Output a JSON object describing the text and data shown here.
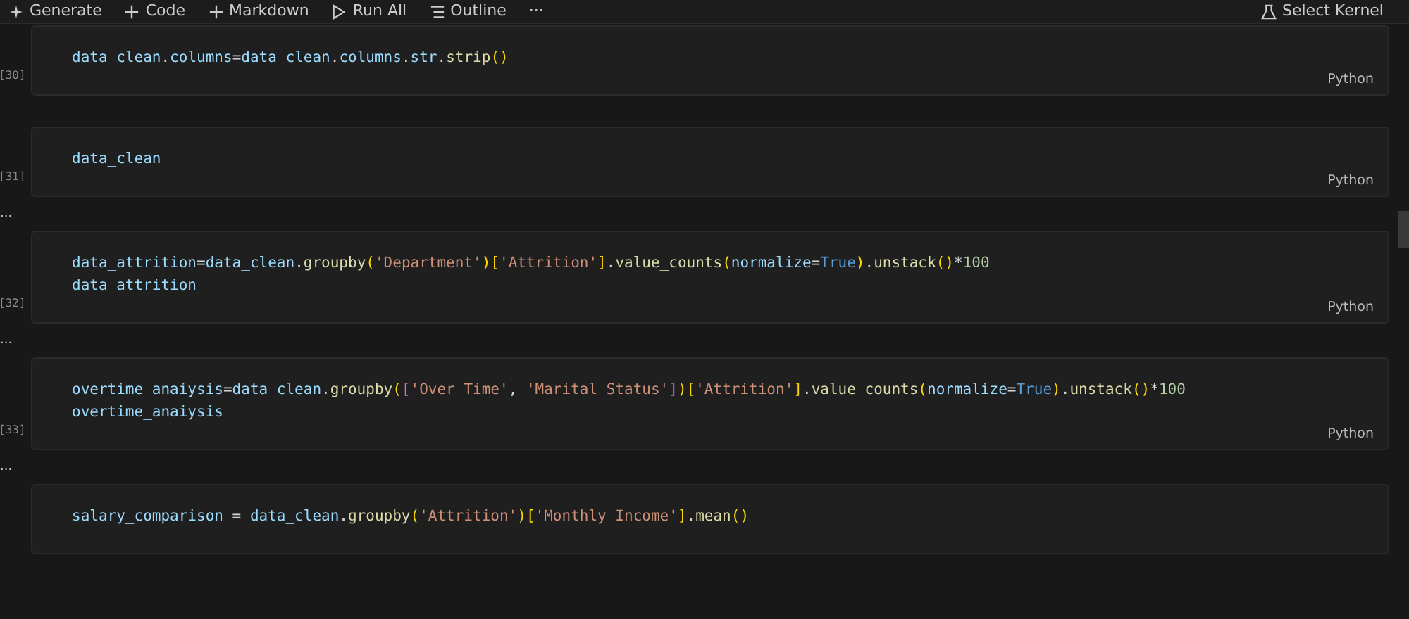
{
  "toolbar": {
    "items": [
      {
        "label": "Generate"
      },
      {
        "label": "Code"
      },
      {
        "label": "Markdown"
      },
      {
        "label": "Run All"
      },
      {
        "label": "Outline"
      },
      {
        "label": "···"
      }
    ],
    "kernel": "Select Kernel"
  },
  "cells": [
    {
      "count": "[30]",
      "language": "Python",
      "lines": [
        [
          {
            "t": "data_clean",
            "kind": "var"
          },
          {
            "t": ".",
            "kind": "op"
          },
          {
            "t": "columns",
            "kind": "var"
          },
          {
            "t": "=",
            "kind": "op"
          },
          {
            "t": "data_clean",
            "kind": "var"
          },
          {
            "t": ".",
            "kind": "op"
          },
          {
            "t": "columns",
            "kind": "var"
          },
          {
            "t": ".",
            "kind": "op"
          },
          {
            "t": "str",
            "kind": "var"
          },
          {
            "t": ".",
            "kind": "op"
          },
          {
            "t": "strip",
            "kind": "func"
          },
          {
            "t": "()",
            "kind": "b1"
          }
        ]
      ]
    },
    {
      "count": "[31]",
      "language": "Python",
      "output": "...",
      "lines": [
        [
          {
            "t": "data_clean",
            "kind": "var"
          }
        ]
      ]
    },
    {
      "count": "[32]",
      "language": "Python",
      "output": "...",
      "lines": [
        [
          {
            "t": "data_attrition",
            "kind": "var"
          },
          {
            "t": "=",
            "kind": "op"
          },
          {
            "t": "data_clean",
            "kind": "var"
          },
          {
            "t": ".",
            "kind": "op"
          },
          {
            "t": "groupby",
            "kind": "func"
          },
          {
            "t": "(",
            "kind": "b1"
          },
          {
            "t": "'Department'",
            "kind": "str"
          },
          {
            "t": ")[",
            "kind": "b1"
          },
          {
            "t": "'Attrition'",
            "kind": "str"
          },
          {
            "t": "]",
            "kind": "b1"
          },
          {
            "t": ".",
            "kind": "op"
          },
          {
            "t": "value_counts",
            "kind": "func"
          },
          {
            "t": "(",
            "kind": "b1"
          },
          {
            "t": "normalize",
            "kind": "var"
          },
          {
            "t": "=",
            "kind": "op"
          },
          {
            "t": "True",
            "kind": "const"
          },
          {
            "t": ")",
            "kind": "b1"
          },
          {
            "t": ".",
            "kind": "op"
          },
          {
            "t": "unstack",
            "kind": "func"
          },
          {
            "t": "()",
            "kind": "b1"
          },
          {
            "t": "*",
            "kind": "op"
          },
          {
            "t": "100",
            "kind": "num"
          }
        ],
        [
          {
            "t": "data_attrition",
            "kind": "var"
          }
        ]
      ]
    },
    {
      "count": "[33]",
      "language": "Python",
      "output": "...",
      "lines": [
        [
          {
            "t": "overtime_anaiysis",
            "kind": "var"
          },
          {
            "t": "=",
            "kind": "op"
          },
          {
            "t": "data_clean",
            "kind": "var"
          },
          {
            "t": ".",
            "kind": "op"
          },
          {
            "t": "groupby",
            "kind": "func"
          },
          {
            "t": "(",
            "kind": "b1"
          },
          {
            "t": "[",
            "kind": "b2"
          },
          {
            "t": "'Over Time'",
            "kind": "str"
          },
          {
            "t": ", ",
            "kind": "op"
          },
          {
            "t": "'Marital Status'",
            "kind": "str"
          },
          {
            "t": "]",
            "kind": "b2"
          },
          {
            "t": ")[",
            "kind": "b1"
          },
          {
            "t": "'Attrition'",
            "kind": "str"
          },
          {
            "t": "]",
            "kind": "b1"
          },
          {
            "t": ".",
            "kind": "op"
          },
          {
            "t": "value_counts",
            "kind": "func"
          },
          {
            "t": "(",
            "kind": "b1"
          },
          {
            "t": "normalize",
            "kind": "var"
          },
          {
            "t": "=",
            "kind": "op"
          },
          {
            "t": "True",
            "kind": "const"
          },
          {
            "t": ")",
            "kind": "b1"
          },
          {
            "t": ".",
            "kind": "op"
          },
          {
            "t": "unstack",
            "kind": "func"
          },
          {
            "t": "()",
            "kind": "b1"
          },
          {
            "t": "*",
            "kind": "op"
          },
          {
            "t": "100",
            "kind": "num"
          }
        ],
        [
          {
            "t": "overtime_anaiysis",
            "kind": "var"
          }
        ]
      ]
    },
    {
      "lines": [
        [
          {
            "t": "salary_comparison",
            "kind": "var"
          },
          {
            "t": " = ",
            "kind": "op"
          },
          {
            "t": "data_clean",
            "kind": "var"
          },
          {
            "t": ".",
            "kind": "op"
          },
          {
            "t": "groupby",
            "kind": "func"
          },
          {
            "t": "(",
            "kind": "b1"
          },
          {
            "t": "'Attrition'",
            "kind": "str"
          },
          {
            "t": ")[",
            "kind": "b1"
          },
          {
            "t": "'Monthly Income'",
            "kind": "str"
          },
          {
            "t": "]",
            "kind": "b1"
          },
          {
            "t": ".",
            "kind": "op"
          },
          {
            "t": "mean",
            "kind": "func"
          },
          {
            "t": "()",
            "kind": "b1"
          }
        ]
      ]
    }
  ]
}
